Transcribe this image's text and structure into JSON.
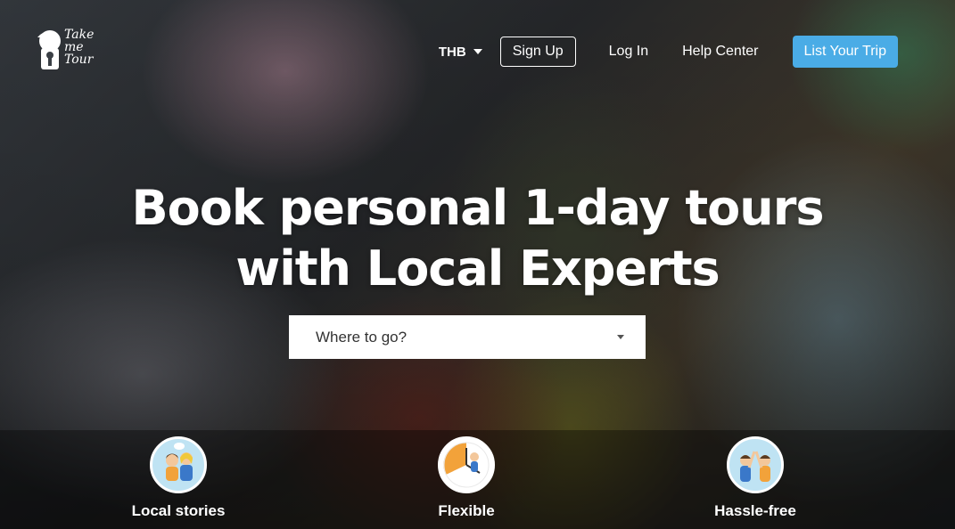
{
  "brand": {
    "name_line1": "Take",
    "name_line2": "me",
    "name_line3": "Tour"
  },
  "nav": {
    "currency": "THB",
    "sign_up": "Sign Up",
    "log_in": "Log In",
    "help_center": "Help Center",
    "list_your_trip": "List Your Trip"
  },
  "hero": {
    "headline_line1": "Book personal 1-day tours",
    "headline_line2": "with Local Experts"
  },
  "search": {
    "placeholder": "Where to go?"
  },
  "features": [
    {
      "label": "Local stories",
      "icon": "local-stories-icon"
    },
    {
      "label": "Flexible",
      "icon": "flexible-clock-icon"
    },
    {
      "label": "Hassle-free",
      "icon": "hassle-free-high-five-icon"
    }
  ],
  "colors": {
    "accent": "#4aace6",
    "white": "#ffffff"
  }
}
